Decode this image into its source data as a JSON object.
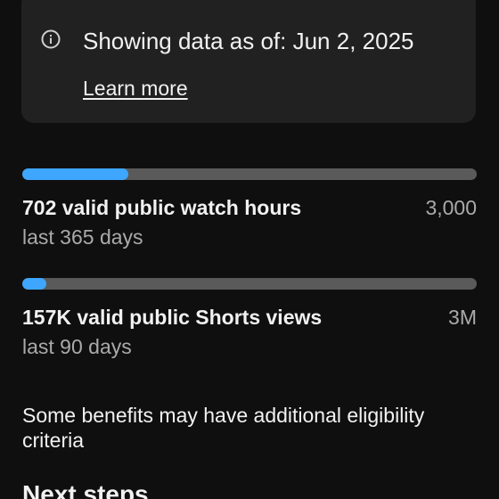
{
  "info_card": {
    "icon": "info-icon",
    "title": "Showing data as of: Jun 2, 2025",
    "link_label": "Learn more"
  },
  "metrics": [
    {
      "label": "702 valid public watch hours",
      "period": "last 365 days",
      "target": "3,000",
      "progress": 0.234
    },
    {
      "label": "157K valid public Shorts views",
      "period": "last 90 days",
      "target": "3M",
      "progress": 0.052
    }
  ],
  "benefits_note": "Some benefits may have additional eligibility criteria",
  "next_steps_heading": "Next steps",
  "colors": {
    "background": "#0f0f0f",
    "card": "#212121",
    "progress_fill": "#3ea6ff",
    "progress_track": "#5a5a5a",
    "secondary_text": "#aaaaaa"
  }
}
